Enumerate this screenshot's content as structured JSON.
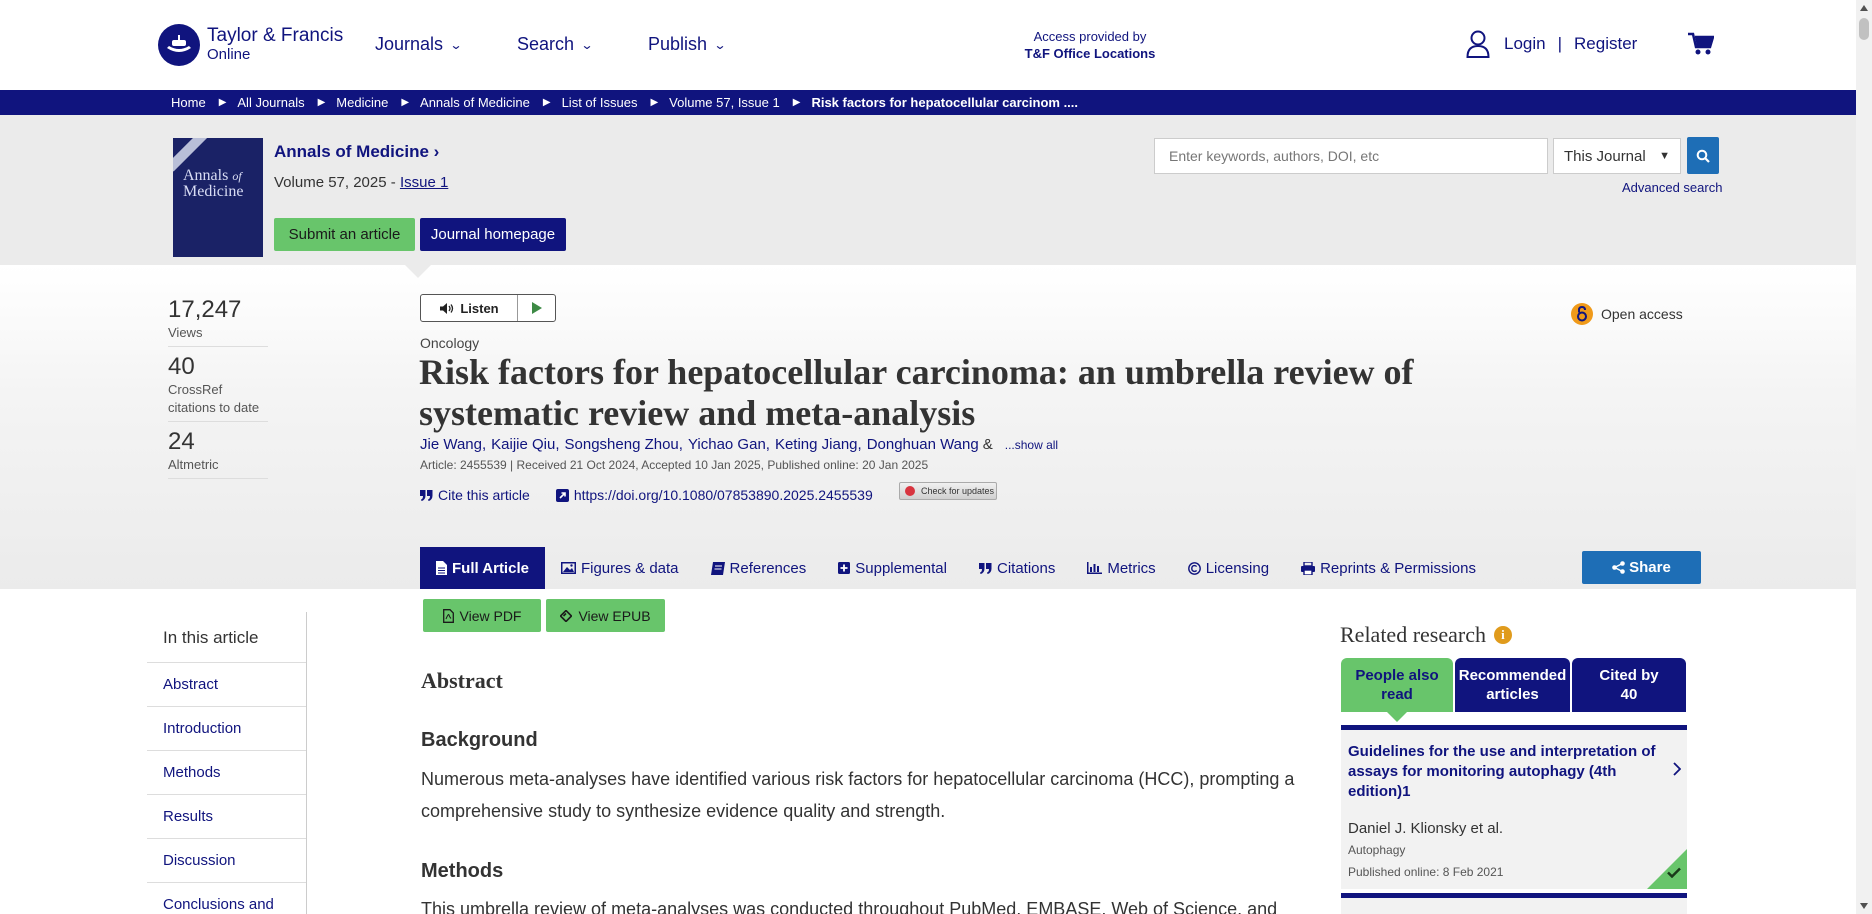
{
  "header": {
    "logo_line1": "Taylor & Francis",
    "logo_line2": "Online",
    "nav": [
      {
        "label": "Journals"
      },
      {
        "label": "Search"
      },
      {
        "label": "Publish"
      }
    ],
    "access_label": "Access provided by",
    "access_org": "T&F Office Locations",
    "login": "Login",
    "separator": "|",
    "register": "Register"
  },
  "breadcrumb": [
    "Home",
    "All Journals",
    "Medicine",
    "Annals of Medicine",
    "List of Issues",
    "Volume 57, Issue 1"
  ],
  "breadcrumb_current": "Risk factors for hepatocellular carcinom ....",
  "journal": {
    "cover_title_1": "Annals",
    "cover_title_2": "of",
    "cover_title_3": "Medicine",
    "name": "Annals of Medicine",
    "name_chevron": "›",
    "volume": "Volume 57, 2025 -",
    "issue": "Issue 1",
    "submit_label": "Submit an article",
    "homepage_label": "Journal homepage"
  },
  "search": {
    "placeholder": "Enter keywords, authors, DOI, etc",
    "scope": "This Journal",
    "advanced": "Advanced search"
  },
  "metrics": [
    {
      "num": "17,247",
      "label": "Views"
    },
    {
      "num": "40",
      "label": "CrossRef citations to date"
    },
    {
      "num": "24",
      "label": "Altmetric"
    }
  ],
  "article": {
    "listen": "Listen",
    "open_access": "Open access",
    "subject": "Oncology",
    "title": "Risk factors for hepatocellular carcinoma: an umbrella review of systematic review and meta-analysis",
    "authors": [
      "Jie Wang,",
      "Kaijie Qiu,",
      "Songsheng Zhou,",
      "Yichao Gan,",
      "Keting Jiang,",
      "Donghuan Wang"
    ],
    "amp": "&",
    "show_all": "...show all",
    "meta": "Article: 2455539 | Received 21 Oct 2024, Accepted 10 Jan 2025, Published online: 20 Jan 2025",
    "cite": "Cite this article",
    "doi": "https://doi.org/10.1080/07853890.2025.2455539",
    "check_updates": "Check for updates"
  },
  "tabs": [
    {
      "label": "Full Article"
    },
    {
      "label": "Figures & data"
    },
    {
      "label": "References"
    },
    {
      "label": "Supplemental"
    },
    {
      "label": "Citations"
    },
    {
      "label": "Metrics"
    },
    {
      "label": "Licensing"
    },
    {
      "label": "Reprints & Permissions"
    }
  ],
  "share": "Share",
  "side_nav": {
    "heading": "In this article",
    "items": [
      "Abstract",
      "Introduction",
      "Methods",
      "Results",
      "Discussion",
      "Conclusions and"
    ]
  },
  "downloads": {
    "pdf": "View PDF",
    "epub": "View EPUB"
  },
  "abstract": {
    "heading": "Abstract",
    "background_h": "Background",
    "background_text": "Numerous meta-analyses have identified various risk factors for hepatocellular carcinoma (HCC), prompting a comprehensive study to synthesize evidence quality and strength.",
    "methods_h": "Methods",
    "methods_text": "This umbrella review of meta-analyses was conducted throughout PubMed, EMBASE, Web of Science, and"
  },
  "related": {
    "heading": "Related research",
    "info": "i",
    "tabs": [
      "People also read",
      "Recommended articles",
      "Cited by 40"
    ],
    "card": {
      "title": "Guidelines for the use and interpretation of assays for monitoring autophagy (4th edition)1",
      "author": "Daniel J. Klionsky et al.",
      "journal": "Autophagy",
      "date": "Published online: 8 Feb 2021"
    }
  },
  "colors": {
    "navy": "#10147e",
    "green": "#68c56b",
    "blue": "#1e6eb6",
    "open_access": "#f09a1a"
  }
}
